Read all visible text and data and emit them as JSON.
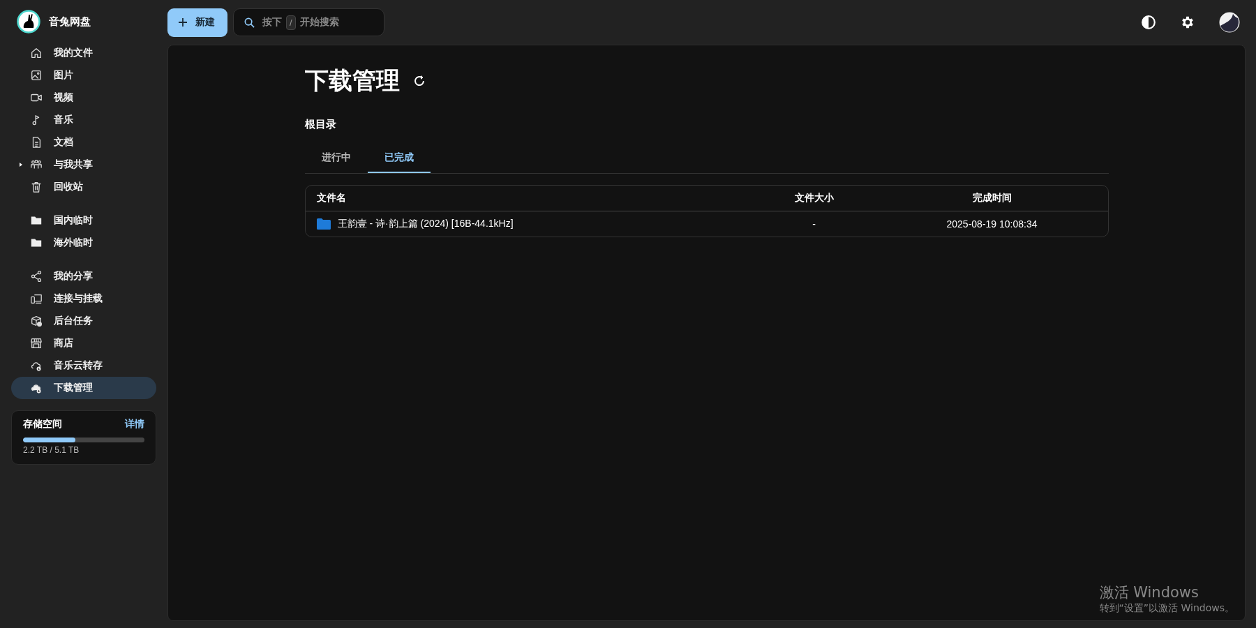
{
  "app": {
    "name": "音兔网盘"
  },
  "sidebar": {
    "groups": [
      {
        "items": [
          {
            "label": "我的文件",
            "selected": false
          },
          {
            "label": "图片",
            "selected": false
          },
          {
            "label": "视频",
            "selected": false
          },
          {
            "label": "音乐",
            "selected": false
          },
          {
            "label": "文档",
            "selected": false
          },
          {
            "label": "与我共享",
            "selected": false,
            "expanded": false
          },
          {
            "label": "回收站",
            "selected": false
          }
        ]
      },
      {
        "items": [
          {
            "label": "国内临时",
            "selected": false
          },
          {
            "label": "海外临时",
            "selected": false
          }
        ]
      },
      {
        "items": [
          {
            "label": "我的分享",
            "selected": false
          },
          {
            "label": "连接与挂载",
            "selected": false
          },
          {
            "label": "后台任务",
            "selected": false
          },
          {
            "label": "商店",
            "selected": false
          },
          {
            "label": "音乐云转存",
            "selected": false
          },
          {
            "label": "下载管理",
            "selected": true
          }
        ]
      }
    ],
    "storage": {
      "title": "存储空间",
      "link": "详情",
      "level": 0.43,
      "reading": "2.2 TB / 5.1 TB"
    }
  },
  "toolbar": {
    "new_button": "新建",
    "search": {
      "placeholder_before": "按下",
      "key": "/",
      "placeholder_after": "开始搜索"
    }
  },
  "page": {
    "title": "下载管理",
    "breadcrumb": "根目录",
    "tabs": [
      {
        "label": "进行中",
        "selected": false
      },
      {
        "label": "已完成",
        "selected": true
      }
    ],
    "table": {
      "columns": [
        "文件名",
        "文件大小",
        "完成时间"
      ],
      "rows": [
        {
          "name": "王韵壹 - 诗·韵上篇 (2024) [16B-44.1kHz]",
          "size": "-",
          "finished": "2025-08-19 10:08:34"
        }
      ]
    }
  },
  "windows_activation": {
    "title": "激活 Windows",
    "subtitle": "转到“设置”以激活 Windows。"
  }
}
